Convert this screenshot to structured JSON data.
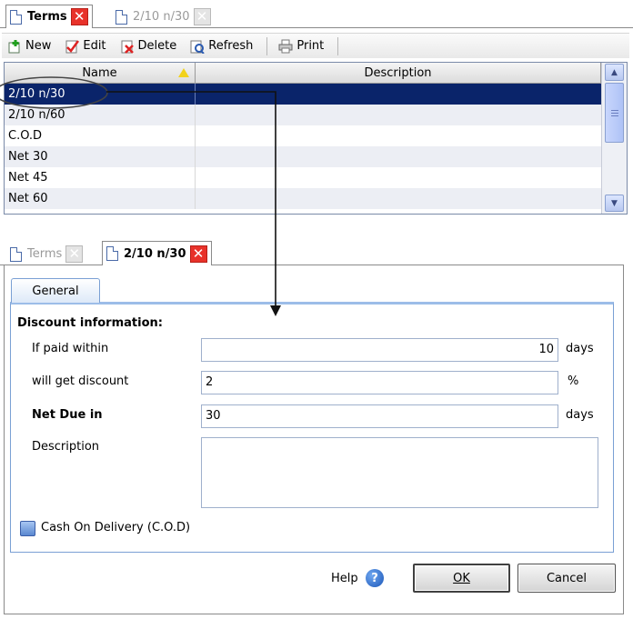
{
  "top_panel": {
    "tabs": [
      {
        "label": "Terms",
        "state": "active"
      },
      {
        "label": "2/10 n/30",
        "state": "inactive"
      }
    ],
    "toolbar": {
      "new": "New",
      "edit": "Edit",
      "delete": "Delete",
      "refresh": "Refresh",
      "print": "Print"
    },
    "grid": {
      "columns": [
        "Name",
        "Description"
      ],
      "rows": [
        {
          "name": "2/10 n/30",
          "description": "",
          "selected": true
        },
        {
          "name": "2/10 n/60",
          "description": ""
        },
        {
          "name": "C.O.D",
          "description": ""
        },
        {
          "name": "Net 30",
          "description": ""
        },
        {
          "name": "Net 45",
          "description": ""
        },
        {
          "name": "Net 60",
          "description": ""
        }
      ]
    }
  },
  "bottom_panel": {
    "tabs": [
      {
        "label": "Terms",
        "state": "inactive"
      },
      {
        "label": "2/10 n/30",
        "state": "active"
      }
    ],
    "page_tab": "General",
    "section_title": "Discount information:",
    "fields": {
      "paid_within": {
        "label": "If paid within",
        "value": "10",
        "unit": "days"
      },
      "discount": {
        "label": "will get discount",
        "value": "2",
        "unit": "%"
      },
      "net_due": {
        "label": "Net Due in",
        "value": "30",
        "unit": "days"
      },
      "description": {
        "label": "Description",
        "value": ""
      }
    },
    "cod_checkbox": {
      "label": "Cash On Delivery (C.O.D)",
      "checked": false
    },
    "footer": {
      "help": "Help",
      "ok": "OK",
      "cancel": "Cancel"
    }
  },
  "colors": {
    "selection": "#0a246a",
    "close_active": "#e8322a",
    "tab_border": "#7aa0d4"
  },
  "icons": [
    "new-icon",
    "edit-icon",
    "delete-icon",
    "refresh-icon",
    "print-icon",
    "help-icon",
    "doc-icon",
    "close-icon",
    "sort-ascending-icon"
  ]
}
